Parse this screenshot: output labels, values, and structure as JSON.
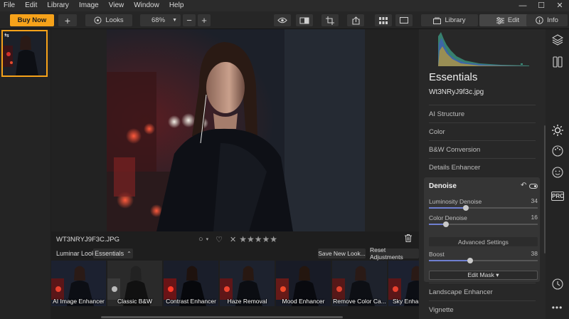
{
  "menu": [
    "File",
    "Edit",
    "Library",
    "Image",
    "View",
    "Window",
    "Help"
  ],
  "window_controls": [
    "—",
    "☐",
    "✕"
  ],
  "toolbar": {
    "buy_now": "Buy Now",
    "add": "+",
    "looks": "Looks",
    "zoom_value": "68%",
    "zoom_minus": "−",
    "zoom_plus": "+",
    "library_tab": "Library",
    "edit_tab": "Edit",
    "info_tab": "Info"
  },
  "canvas": {
    "filename": "WT3NRYJ9F3C.JPG",
    "rating_stars": "★★★★★"
  },
  "looks_bar": {
    "label": "Luminar Looks:",
    "category": "Essentials",
    "save_new_look": "Save New Look...",
    "reset_adjustments": "Reset Adjustments"
  },
  "looks": [
    {
      "name": "AI Image Enhancer"
    },
    {
      "name": "Classic B&W"
    },
    {
      "name": "Contrast Enhancer"
    },
    {
      "name": "Haze Removal"
    },
    {
      "name": "Mood Enhancer"
    },
    {
      "name": "Remove Color Ca..."
    },
    {
      "name": "Sky Enhan"
    }
  ],
  "panel": {
    "title": "Essentials",
    "filename": "Wt3NRyJ9f3c.jpg",
    "tools_top": [
      "AI Structure",
      "Color",
      "B&W Conversion",
      "Details Enhancer"
    ],
    "denoise": {
      "title": "Denoise",
      "luminosity_label": "Luminosity Denoise",
      "luminosity_value": "34",
      "color_label": "Color Denoise",
      "color_value": "16",
      "advanced": "Advanced Settings",
      "boost_label": "Boost",
      "boost_value": "38",
      "edit_mask": "Edit Mask ▾"
    },
    "tools_bottom": [
      "Landscape Enhancer",
      "Vignette"
    ]
  },
  "slider_levels": {
    "luminosity": 0.34,
    "color": 0.16,
    "boost": 0.38
  }
}
